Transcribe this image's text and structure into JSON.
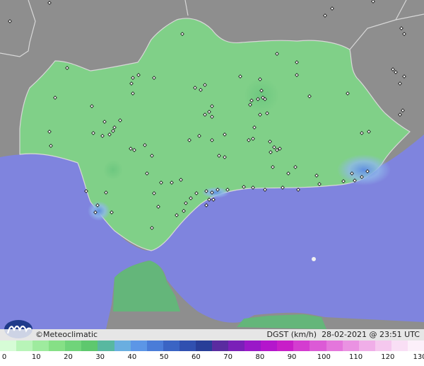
{
  "brand": "©Meteoclimatic",
  "product_label": "DGST (km/h)",
  "timestamp": "28-02-2021 @ 23:51 UTC",
  "scale": {
    "ticks": [
      "0",
      "10",
      "20",
      "30",
      "40",
      "50",
      "60",
      "70",
      "80",
      "90",
      "100",
      "110",
      "120",
      "130"
    ],
    "colors": [
      "#d6fcd6",
      "#b8f4b8",
      "#9eeb9e",
      "#86e086",
      "#70d47a",
      "#5ec86e",
      "#58b8a0",
      "#6aaee0",
      "#5c96e6",
      "#4a7cd8",
      "#3a64c4",
      "#3050b0",
      "#283e98",
      "#5a2ca0",
      "#7a20b8",
      "#9a18c8",
      "#b416cc",
      "#c81ec8",
      "#d43cd0",
      "#dc5ad6",
      "#e476dc",
      "#ea92e2",
      "#f0aee8",
      "#f5c8ee",
      "#f9dff5",
      "#fcf0fa"
    ]
  },
  "colors": {
    "land_outside": "#8e8e8e",
    "sea": "#7f84de",
    "andalusia": "#7fcf86",
    "border": "#d8d8d8"
  }
}
